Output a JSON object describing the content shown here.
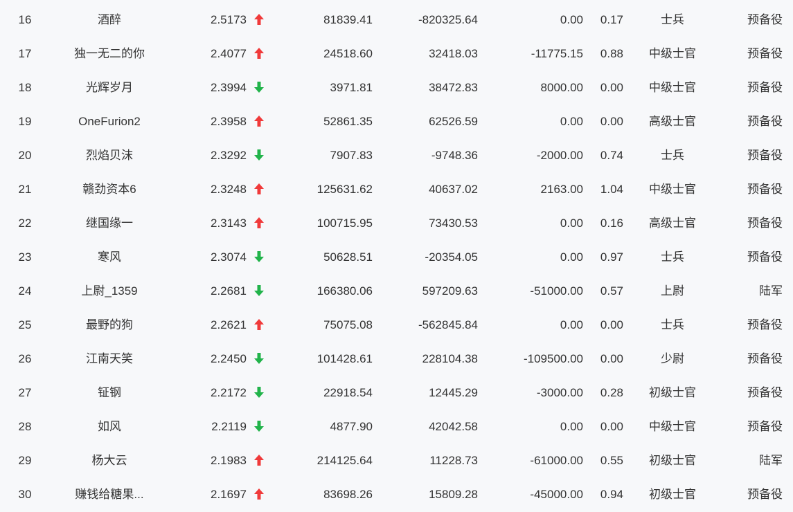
{
  "colors": {
    "up": "#f03a3a",
    "down": "#21b34a"
  },
  "rows": [
    {
      "rank": "16",
      "name": "酒醉",
      "score": "2.5173",
      "trend": "up",
      "v1": "81839.41",
      "v2": "-820325.64",
      "v3": "0.00",
      "v4": "0.17",
      "title": "士兵",
      "branch": "预备役"
    },
    {
      "rank": "17",
      "name": "独一无二的你",
      "score": "2.4077",
      "trend": "up",
      "v1": "24518.60",
      "v2": "32418.03",
      "v3": "-11775.15",
      "v4": "0.88",
      "title": "中级士官",
      "branch": "预备役"
    },
    {
      "rank": "18",
      "name": "光辉岁月",
      "score": "2.3994",
      "trend": "down",
      "v1": "3971.81",
      "v2": "38472.83",
      "v3": "8000.00",
      "v4": "0.00",
      "title": "中级士官",
      "branch": "预备役"
    },
    {
      "rank": "19",
      "name": "OneFurion2",
      "score": "2.3958",
      "trend": "up",
      "v1": "52861.35",
      "v2": "62526.59",
      "v3": "0.00",
      "v4": "0.00",
      "title": "高级士官",
      "branch": "预备役"
    },
    {
      "rank": "20",
      "name": "烈焰贝沫",
      "score": "2.3292",
      "trend": "down",
      "v1": "7907.83",
      "v2": "-9748.36",
      "v3": "-2000.00",
      "v4": "0.74",
      "title": "士兵",
      "branch": "预备役"
    },
    {
      "rank": "21",
      "name": "赣劲资本6",
      "score": "2.3248",
      "trend": "up",
      "v1": "125631.62",
      "v2": "40637.02",
      "v3": "2163.00",
      "v4": "1.04",
      "title": "中级士官",
      "branch": "预备役"
    },
    {
      "rank": "22",
      "name": "继国缘一",
      "score": "2.3143",
      "trend": "up",
      "v1": "100715.95",
      "v2": "73430.53",
      "v3": "0.00",
      "v4": "0.16",
      "title": "高级士官",
      "branch": "预备役"
    },
    {
      "rank": "23",
      "name": "寒风",
      "score": "2.3074",
      "trend": "down",
      "v1": "50628.51",
      "v2": "-20354.05",
      "v3": "0.00",
      "v4": "0.97",
      "title": "士兵",
      "branch": "预备役"
    },
    {
      "rank": "24",
      "name": "上尉_1359",
      "score": "2.2681",
      "trend": "down",
      "v1": "166380.06",
      "v2": "597209.63",
      "v3": "-51000.00",
      "v4": "0.57",
      "title": "上尉",
      "branch": "陆军"
    },
    {
      "rank": "25",
      "name": "最野的狗",
      "score": "2.2621",
      "trend": "up",
      "v1": "75075.08",
      "v2": "-562845.84",
      "v3": "0.00",
      "v4": "0.00",
      "title": "士兵",
      "branch": "预备役"
    },
    {
      "rank": "26",
      "name": "江南天笑",
      "score": "2.2450",
      "trend": "down",
      "v1": "101428.61",
      "v2": "228104.38",
      "v3": "-109500.00",
      "v4": "0.00",
      "title": "少尉",
      "branch": "预备役"
    },
    {
      "rank": "27",
      "name": "钲钢",
      "score": "2.2172",
      "trend": "down",
      "v1": "22918.54",
      "v2": "12445.29",
      "v3": "-3000.00",
      "v4": "0.28",
      "title": "初级士官",
      "branch": "预备役"
    },
    {
      "rank": "28",
      "name": "如风",
      "score": "2.2119",
      "trend": "down",
      "v1": "4877.90",
      "v2": "42042.58",
      "v3": "0.00",
      "v4": "0.00",
      "title": "中级士官",
      "branch": "预备役"
    },
    {
      "rank": "29",
      "name": "杨大云",
      "score": "2.1983",
      "trend": "up",
      "v1": "214125.64",
      "v2": "11228.73",
      "v3": "-61000.00",
      "v4": "0.55",
      "title": "初级士官",
      "branch": "陆军"
    },
    {
      "rank": "30",
      "name": "赚钱给糖果...",
      "score": "2.1697",
      "trend": "up",
      "v1": "83698.26",
      "v2": "15809.28",
      "v3": "-45000.00",
      "v4": "0.94",
      "title": "初级士官",
      "branch": "预备役"
    }
  ]
}
